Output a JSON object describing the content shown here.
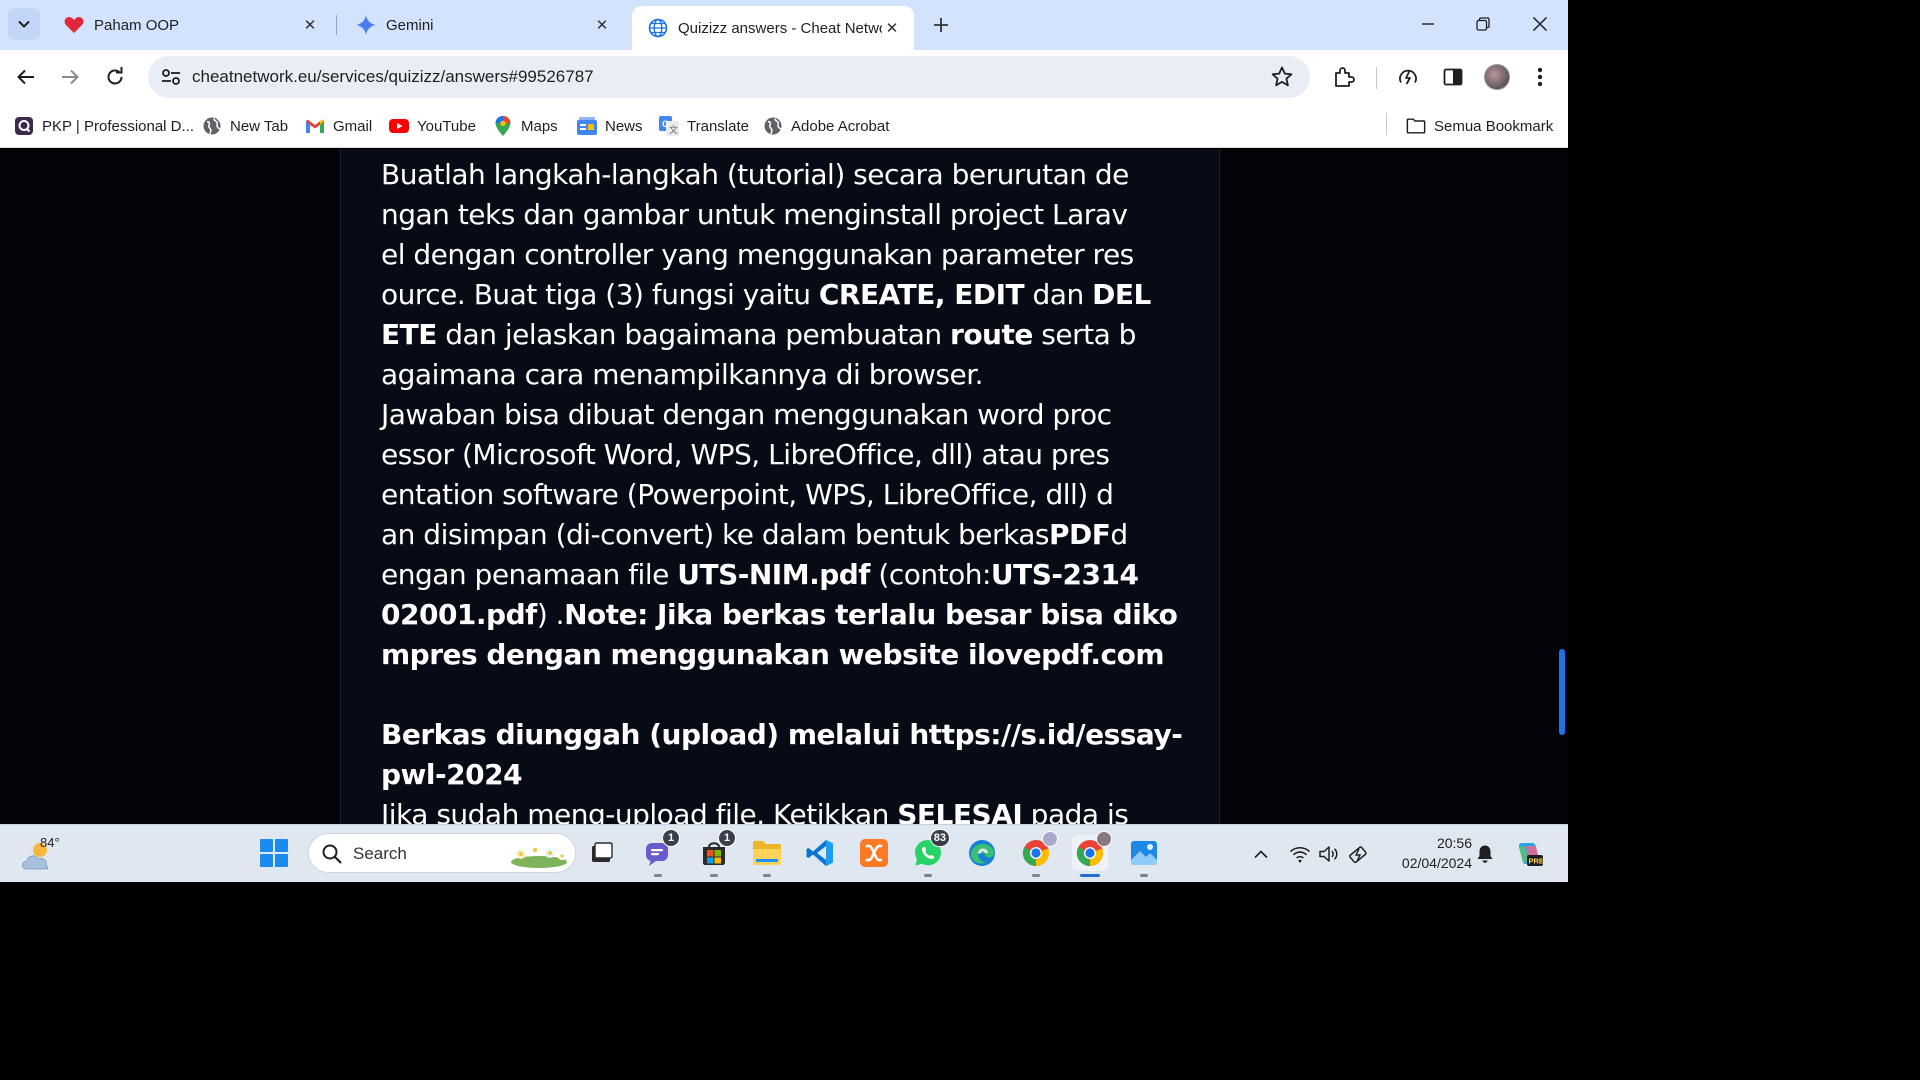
{
  "tabs": [
    {
      "title": "Paham OOP",
      "icon": "heart-icon",
      "active": false
    },
    {
      "title": "Gemini",
      "icon": "gemini-sparkle-icon",
      "active": false
    },
    {
      "title": "Quizizz answers - Cheat Networ",
      "icon": "globe-icon",
      "active": true
    }
  ],
  "address_bar": {
    "url": "cheatnetwork.eu/services/quizizz/answers#99526787"
  },
  "bookmarks": [
    {
      "label": "PKP | Professional D...",
      "icon": "pkp-icon"
    },
    {
      "label": "New Tab",
      "icon": "globe-icon"
    },
    {
      "label": "Gmail",
      "icon": "gmail-icon"
    },
    {
      "label": "YouTube",
      "icon": "youtube-icon"
    },
    {
      "label": "Maps",
      "icon": "maps-icon"
    },
    {
      "label": "News",
      "icon": "news-icon"
    },
    {
      "label": "Translate",
      "icon": "translate-icon"
    },
    {
      "label": "Adobe Acrobat",
      "icon": "globe-icon"
    }
  ],
  "all_bookmarks": {
    "label": "Semua Bookmark"
  },
  "question": {
    "l1": "Buatlah langkah-langkah (tutorial) secara berurutan de",
    "l2": "ngan teks dan gambar untuk menginstall project Larav",
    "l3": "el dengan controller yang menggunakan parameter res",
    "l4a": "ource. Buat tiga (3) fungsi yaitu ",
    "l4b": "CREATE, EDIT",
    "l4c": " dan ",
    "l4d": "DEL",
    "l5a": "ETE",
    "l5b": " dan jelaskan bagaimana pembuatan ",
    "l5c": "route",
    "l5d": " serta b",
    "l6": "agaimana cara menampilkannya di browser.",
    "l7": "Jawaban bisa dibuat dengan menggunakan word proc",
    "l8": "essor (Microsoft Word, WPS, LibreOffice, dll) atau pres",
    "l9": "entation software (Powerpoint, WPS, LibreOffice, dll) d",
    "l10a": "an disimpan (di-convert) ke dalam bentuk berkas",
    "l10b": "PDF",
    "l10c": "d",
    "l11a": "engan penamaan file ",
    "l11b": "UTS-NIM.pdf",
    "l11c": " (contoh:",
    "l11d": "UTS-2314",
    "l12a": "02001.pdf",
    "l12b": ") .",
    "l12c": "Note: Jika berkas terlalu besar bisa diko",
    "l13": "mpres dengan menggunakan website ilovepdf.com",
    "l14": "Berkas diunggah (upload) melalui https://s.id/essay-",
    "l15": "pwl-2024",
    "l16a": "Jika sudah meng-upload file. Ketikkan ",
    "l16b": "SELESAI",
    "l16c": " pada is"
  },
  "taskbar": {
    "weather": {
      "temp": "84°"
    },
    "search_label": "Search",
    "apps": [
      {
        "name": "start",
        "icon": "windows-start-icon"
      },
      {
        "name": "task-view",
        "icon": "task-view-icon"
      },
      {
        "name": "teams-chat",
        "icon": "chat-icon",
        "badge": "1"
      },
      {
        "name": "microsoft-store",
        "icon": "store-icon",
        "badge": "1"
      },
      {
        "name": "file-explorer",
        "icon": "folder-icon"
      },
      {
        "name": "vscode",
        "icon": "vscode-icon"
      },
      {
        "name": "xampp",
        "icon": "xampp-icon"
      },
      {
        "name": "whatsapp",
        "icon": "whatsapp-icon",
        "badge": "83"
      },
      {
        "name": "edge",
        "icon": "edge-icon"
      },
      {
        "name": "chrome-profile-1",
        "icon": "chrome-icon"
      },
      {
        "name": "chrome-profile-2",
        "icon": "chrome-icon"
      },
      {
        "name": "photos",
        "icon": "photos-icon"
      }
    ],
    "clock": {
      "time": "20:56",
      "date": "02/04/2024"
    }
  },
  "colors": {
    "tabstrip": "#d3e3fd",
    "page_background": "#02040a",
    "text": "#ffffff",
    "accent": "#1a73e8"
  }
}
